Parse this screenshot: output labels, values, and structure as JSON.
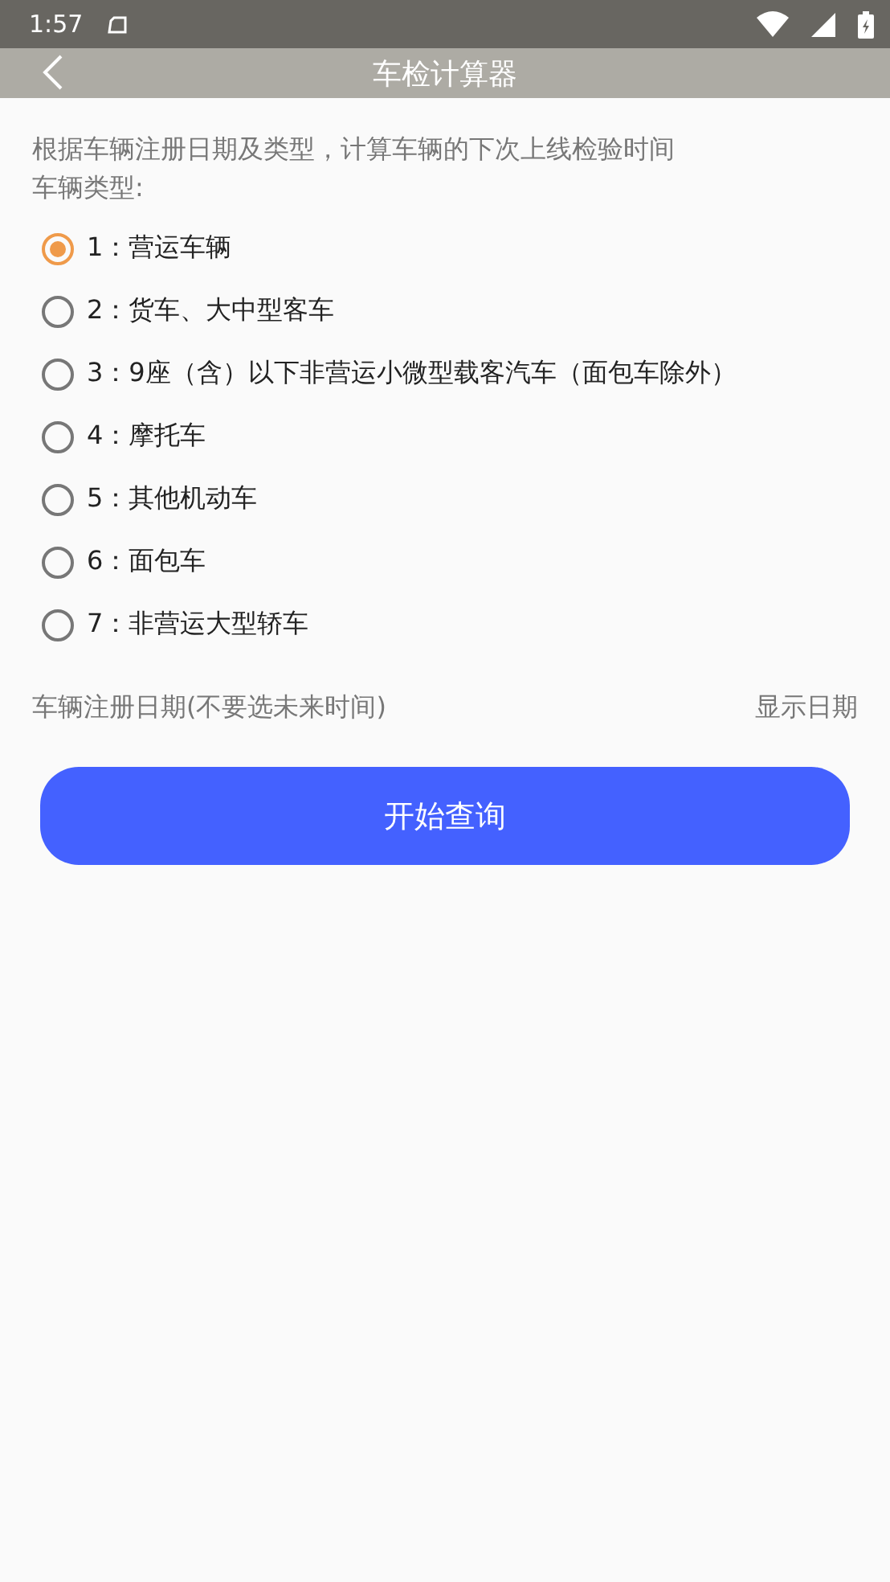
{
  "status_bar": {
    "time": "1:57"
  },
  "app_bar": {
    "title": "车检计算器"
  },
  "description": "根据车辆注册日期及类型，计算车辆的下次上线检验时间",
  "type_label": "车辆类型:",
  "vehicle_types": [
    {
      "label": "1：营运车辆",
      "selected": true
    },
    {
      "label": "2：货车、大中型客车",
      "selected": false
    },
    {
      "label": "3：9座（含）以下非营运小微型载客汽车（面包车除外）",
      "selected": false
    },
    {
      "label": "4：摩托车",
      "selected": false
    },
    {
      "label": "5：其他机动车",
      "selected": false
    },
    {
      "label": "6：面包车",
      "selected": false
    },
    {
      "label": "7：非营运大型轿车",
      "selected": false
    }
  ],
  "date_row": {
    "label": "车辆注册日期(不要选未来时间)",
    "value": "显示日期"
  },
  "button": "开始查询"
}
